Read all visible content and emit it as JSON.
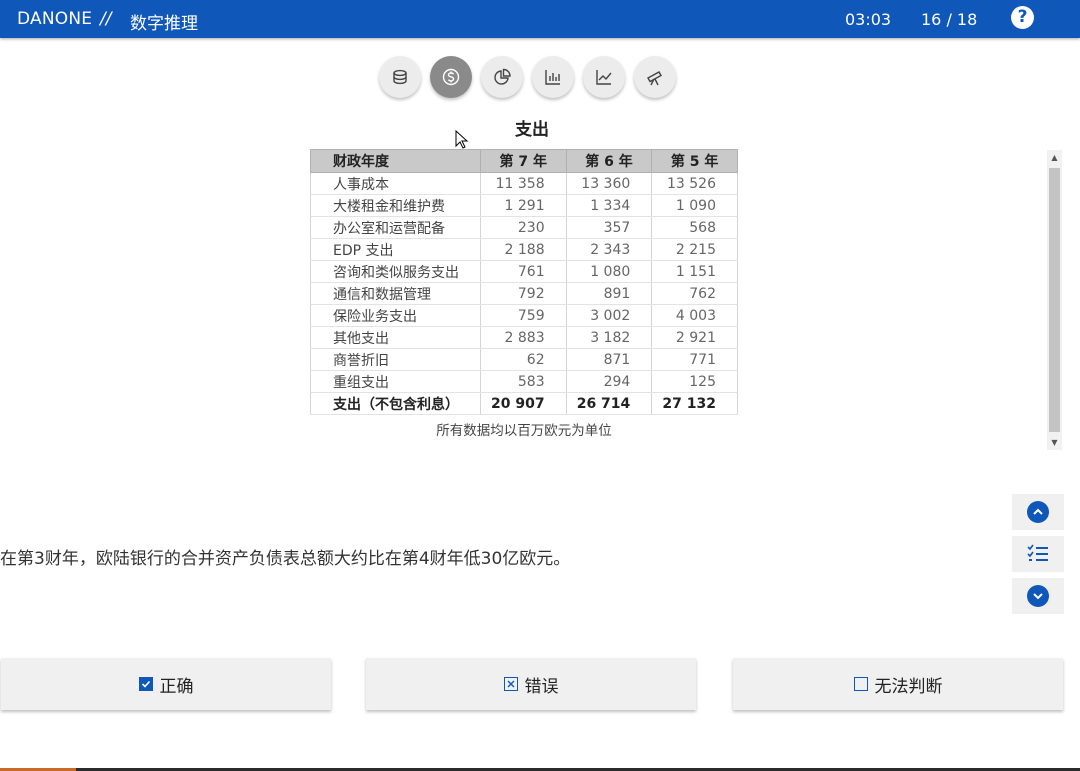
{
  "header": {
    "brand": "DANONE",
    "separator": "//",
    "section": "数字推理",
    "timer": "03:03",
    "progress": "16 / 18",
    "help_label": "?"
  },
  "toolbar": {
    "icons": [
      "coins-icon",
      "dollar-icon",
      "pie-chart-icon",
      "bar-chart-icon",
      "line-chart-icon",
      "telescope-icon"
    ],
    "active_index": 1
  },
  "table": {
    "title": "支出",
    "headers": [
      "财政年度",
      "第 7 年",
      "第 6 年",
      "第 5 年"
    ],
    "rows": [
      [
        "人事成本",
        "11 358",
        "13 360",
        "13 526"
      ],
      [
        "大楼租金和维护费",
        "1 291",
        "1 334",
        "1 090"
      ],
      [
        "办公室和运营配备",
        "230",
        "357",
        "568"
      ],
      [
        "EDP 支出",
        "2 188",
        "2 343",
        "2 215"
      ],
      [
        "咨询和类似服务支出",
        "761",
        "1 080",
        "1 151"
      ],
      [
        "通信和数据管理",
        "792",
        "891",
        "762"
      ],
      [
        "保险业务支出",
        "759",
        "3 002",
        "4 003"
      ],
      [
        "其他支出",
        "2 883",
        "3 182",
        "2 921"
      ],
      [
        "商誉折旧",
        "62",
        "871",
        "771"
      ],
      [
        "重组支出",
        "583",
        "294",
        "125"
      ]
    ],
    "total": [
      "支出（不包含利息）",
      "20 907",
      "26 714",
      "27 132"
    ],
    "note": "所有数据均以百万欧元为单位"
  },
  "statement": "在第3财年，欧陆银行的合并资产负债表总额大约比在第4财年低30亿欧元。",
  "answers": {
    "correct": "正确",
    "wrong": "错误",
    "cannot_say": "无法判断"
  },
  "colors": {
    "header_bg": "#0f57b8",
    "accent": "#0f57b8"
  }
}
